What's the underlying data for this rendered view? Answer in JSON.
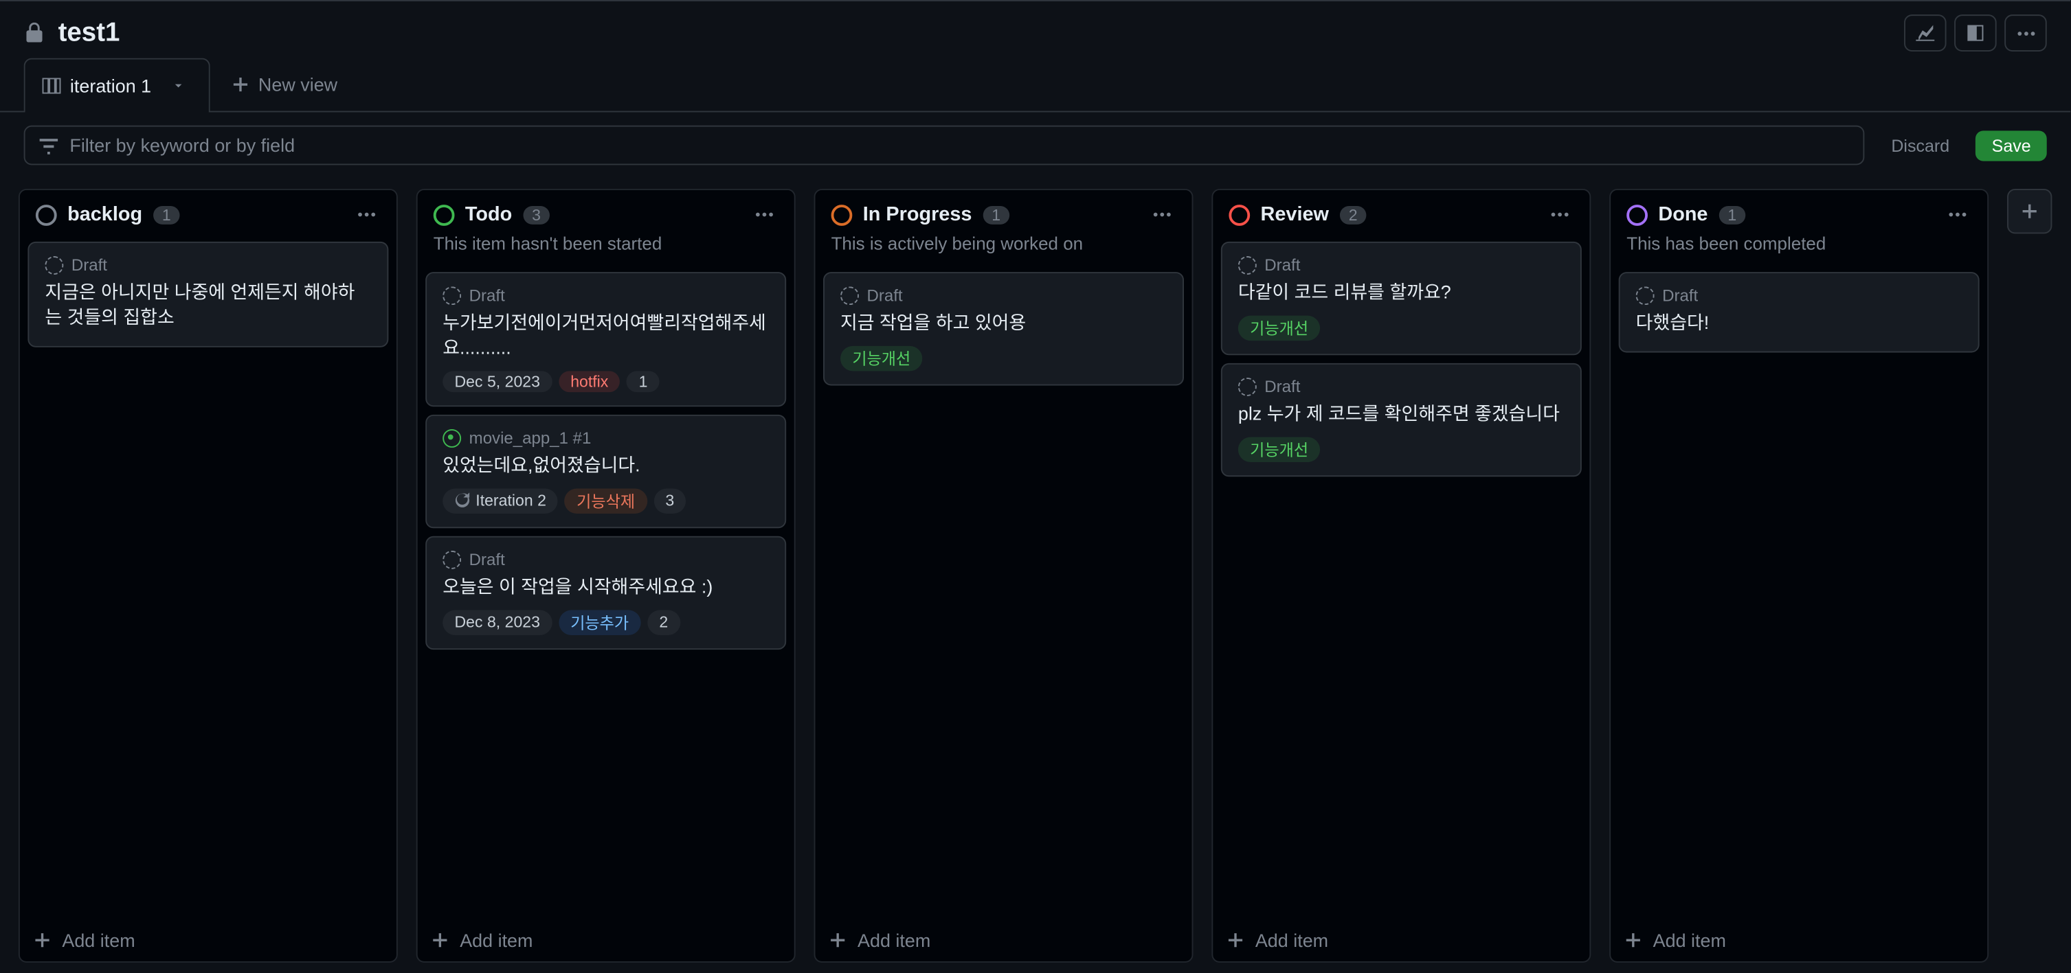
{
  "header": {
    "title": "test1"
  },
  "tabs": {
    "active": "iteration 1",
    "new_view": "New view"
  },
  "filter": {
    "placeholder": "Filter by keyword or by field",
    "discard": "Discard",
    "save": "Save"
  },
  "columns": [
    {
      "id": "backlog",
      "name": "backlog",
      "color": "gray",
      "count": "1",
      "desc": "",
      "cards": [
        {
          "kind": "draft",
          "type_label": "Draft",
          "title": "지금은 아니지만 나중에 언제든지 해야하는 것들의 집합소",
          "pills": []
        }
      ]
    },
    {
      "id": "todo",
      "name": "Todo",
      "color": "green",
      "count": "3",
      "desc": "This item hasn't been started",
      "cards": [
        {
          "kind": "draft",
          "type_label": "Draft",
          "title": "누가보기전에이거먼저어여빨리작업해주세요..........",
          "pills": [
            {
              "cls": "p-date",
              "text": "Dec 5, 2023"
            },
            {
              "cls": "p-hotfix",
              "text": "hotfix"
            },
            {
              "cls": "p-num",
              "text": "1"
            }
          ]
        },
        {
          "kind": "issue",
          "type_label": "movie_app_1 #1",
          "title": "있었는데요,없어졌습니다.",
          "pills": [
            {
              "cls": "p-iter",
              "text": "Iteration 2",
              "icon": "iter"
            },
            {
              "cls": "p-func-del",
              "text": "기능삭제"
            },
            {
              "cls": "p-num",
              "text": "3"
            }
          ]
        },
        {
          "kind": "draft",
          "type_label": "Draft",
          "title": "오늘은 이 작업을 시작해주세요요 :)",
          "pills": [
            {
              "cls": "p-date",
              "text": "Dec 8, 2023"
            },
            {
              "cls": "p-func-add",
              "text": "기능추가"
            },
            {
              "cls": "p-num",
              "text": "2"
            }
          ]
        }
      ]
    },
    {
      "id": "inprogress",
      "name": "In Progress",
      "color": "orange",
      "count": "1",
      "desc": "This is actively being worked on",
      "cards": [
        {
          "kind": "draft",
          "type_label": "Draft",
          "title": "지금 작업을 하고 있어용",
          "pills": [
            {
              "cls": "p-func-imp",
              "text": "기능개선"
            }
          ]
        }
      ]
    },
    {
      "id": "review",
      "name": "Review",
      "color": "red",
      "count": "2",
      "desc": "",
      "cards": [
        {
          "kind": "draft",
          "type_label": "Draft",
          "title": "다같이 코드 리뷰를 할까요?",
          "pills": [
            {
              "cls": "p-func-imp",
              "text": "기능개선"
            }
          ]
        },
        {
          "kind": "draft",
          "type_label": "Draft",
          "title": "plz 누가 제 코드를 확인해주면 좋겠습니다",
          "pills": [
            {
              "cls": "p-func-imp",
              "text": "기능개선"
            }
          ]
        }
      ]
    },
    {
      "id": "done",
      "name": "Done",
      "color": "purple",
      "count": "1",
      "desc": "This has been completed",
      "cards": [
        {
          "kind": "draft",
          "type_label": "Draft",
          "title": "다했습다!",
          "pills": []
        }
      ]
    }
  ],
  "add_item": "Add item"
}
